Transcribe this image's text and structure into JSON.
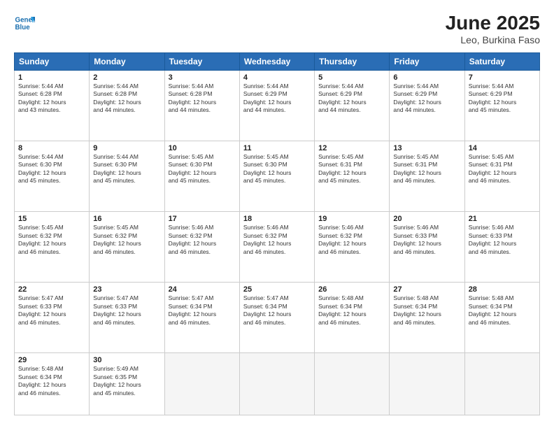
{
  "logo": {
    "line1": "General",
    "line2": "Blue"
  },
  "header": {
    "title": "June 2025",
    "subtitle": "Leo, Burkina Faso"
  },
  "weekdays": [
    "Sunday",
    "Monday",
    "Tuesday",
    "Wednesday",
    "Thursday",
    "Friday",
    "Saturday"
  ],
  "weeks": [
    [
      {
        "day": "1",
        "info": "Sunrise: 5:44 AM\nSunset: 6:28 PM\nDaylight: 12 hours\nand 43 minutes."
      },
      {
        "day": "2",
        "info": "Sunrise: 5:44 AM\nSunset: 6:28 PM\nDaylight: 12 hours\nand 44 minutes."
      },
      {
        "day": "3",
        "info": "Sunrise: 5:44 AM\nSunset: 6:28 PM\nDaylight: 12 hours\nand 44 minutes."
      },
      {
        "day": "4",
        "info": "Sunrise: 5:44 AM\nSunset: 6:29 PM\nDaylight: 12 hours\nand 44 minutes."
      },
      {
        "day": "5",
        "info": "Sunrise: 5:44 AM\nSunset: 6:29 PM\nDaylight: 12 hours\nand 44 minutes."
      },
      {
        "day": "6",
        "info": "Sunrise: 5:44 AM\nSunset: 6:29 PM\nDaylight: 12 hours\nand 44 minutes."
      },
      {
        "day": "7",
        "info": "Sunrise: 5:44 AM\nSunset: 6:29 PM\nDaylight: 12 hours\nand 45 minutes."
      }
    ],
    [
      {
        "day": "8",
        "info": "Sunrise: 5:44 AM\nSunset: 6:30 PM\nDaylight: 12 hours\nand 45 minutes."
      },
      {
        "day": "9",
        "info": "Sunrise: 5:44 AM\nSunset: 6:30 PM\nDaylight: 12 hours\nand 45 minutes."
      },
      {
        "day": "10",
        "info": "Sunrise: 5:45 AM\nSunset: 6:30 PM\nDaylight: 12 hours\nand 45 minutes."
      },
      {
        "day": "11",
        "info": "Sunrise: 5:45 AM\nSunset: 6:30 PM\nDaylight: 12 hours\nand 45 minutes."
      },
      {
        "day": "12",
        "info": "Sunrise: 5:45 AM\nSunset: 6:31 PM\nDaylight: 12 hours\nand 45 minutes."
      },
      {
        "day": "13",
        "info": "Sunrise: 5:45 AM\nSunset: 6:31 PM\nDaylight: 12 hours\nand 46 minutes."
      },
      {
        "day": "14",
        "info": "Sunrise: 5:45 AM\nSunset: 6:31 PM\nDaylight: 12 hours\nand 46 minutes."
      }
    ],
    [
      {
        "day": "15",
        "info": "Sunrise: 5:45 AM\nSunset: 6:32 PM\nDaylight: 12 hours\nand 46 minutes."
      },
      {
        "day": "16",
        "info": "Sunrise: 5:45 AM\nSunset: 6:32 PM\nDaylight: 12 hours\nand 46 minutes."
      },
      {
        "day": "17",
        "info": "Sunrise: 5:46 AM\nSunset: 6:32 PM\nDaylight: 12 hours\nand 46 minutes."
      },
      {
        "day": "18",
        "info": "Sunrise: 5:46 AM\nSunset: 6:32 PM\nDaylight: 12 hours\nand 46 minutes."
      },
      {
        "day": "19",
        "info": "Sunrise: 5:46 AM\nSunset: 6:32 PM\nDaylight: 12 hours\nand 46 minutes."
      },
      {
        "day": "20",
        "info": "Sunrise: 5:46 AM\nSunset: 6:33 PM\nDaylight: 12 hours\nand 46 minutes."
      },
      {
        "day": "21",
        "info": "Sunrise: 5:46 AM\nSunset: 6:33 PM\nDaylight: 12 hours\nand 46 minutes."
      }
    ],
    [
      {
        "day": "22",
        "info": "Sunrise: 5:47 AM\nSunset: 6:33 PM\nDaylight: 12 hours\nand 46 minutes."
      },
      {
        "day": "23",
        "info": "Sunrise: 5:47 AM\nSunset: 6:33 PM\nDaylight: 12 hours\nand 46 minutes."
      },
      {
        "day": "24",
        "info": "Sunrise: 5:47 AM\nSunset: 6:34 PM\nDaylight: 12 hours\nand 46 minutes."
      },
      {
        "day": "25",
        "info": "Sunrise: 5:47 AM\nSunset: 6:34 PM\nDaylight: 12 hours\nand 46 minutes."
      },
      {
        "day": "26",
        "info": "Sunrise: 5:48 AM\nSunset: 6:34 PM\nDaylight: 12 hours\nand 46 minutes."
      },
      {
        "day": "27",
        "info": "Sunrise: 5:48 AM\nSunset: 6:34 PM\nDaylight: 12 hours\nand 46 minutes."
      },
      {
        "day": "28",
        "info": "Sunrise: 5:48 AM\nSunset: 6:34 PM\nDaylight: 12 hours\nand 46 minutes."
      }
    ],
    [
      {
        "day": "29",
        "info": "Sunrise: 5:48 AM\nSunset: 6:34 PM\nDaylight: 12 hours\nand 46 minutes."
      },
      {
        "day": "30",
        "info": "Sunrise: 5:49 AM\nSunset: 6:35 PM\nDaylight: 12 hours\nand 45 minutes."
      },
      {
        "day": "",
        "info": ""
      },
      {
        "day": "",
        "info": ""
      },
      {
        "day": "",
        "info": ""
      },
      {
        "day": "",
        "info": ""
      },
      {
        "day": "",
        "info": ""
      }
    ]
  ]
}
